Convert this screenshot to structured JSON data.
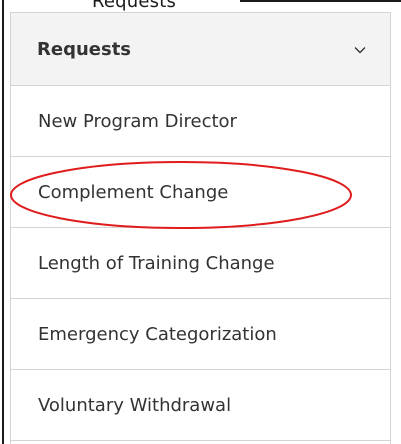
{
  "top_cut_text": "Requests",
  "panel": {
    "title": "Requests",
    "toggle_icon": "chevron-down-icon",
    "items": [
      {
        "label": "New Program Director"
      },
      {
        "label": "Complement Change"
      },
      {
        "label": "Length of Training Change"
      },
      {
        "label": "Emergency Categorization"
      },
      {
        "label": "Voluntary Withdrawal"
      }
    ]
  },
  "annotation": {
    "highlighted_item": "Complement Change",
    "oval_color": "#e01b1b"
  },
  "colors": {
    "header_bg": "#f3f3f3",
    "border": "#d4d4d4",
    "text": "#333333"
  }
}
